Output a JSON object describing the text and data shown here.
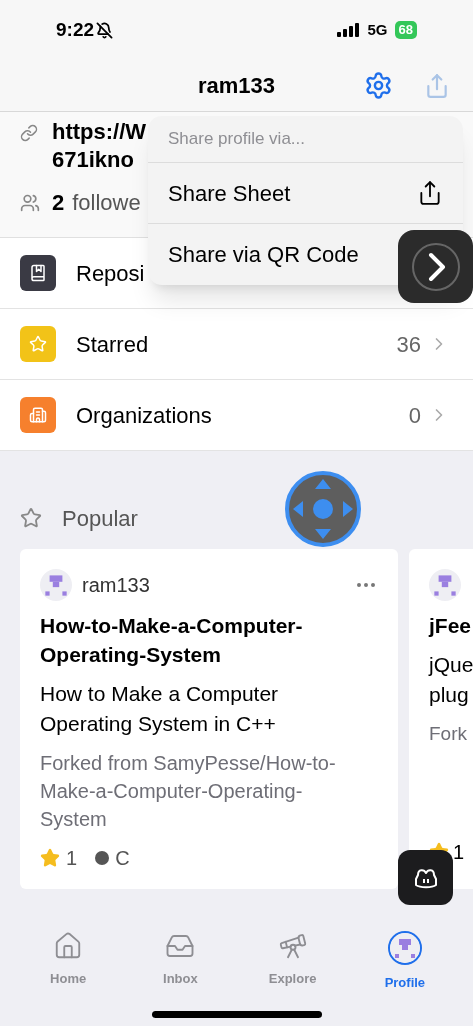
{
  "status_bar": {
    "time": "9:22",
    "network": "5G",
    "battery": "68"
  },
  "nav": {
    "title": "ram133"
  },
  "profile": {
    "link_lines": [
      "https://W",
      "671ikno"
    ],
    "followers_count": "2",
    "followers_label": "followe"
  },
  "share_menu": {
    "header": "Share profile via...",
    "items": [
      {
        "kind": "sheet",
        "label": "Share Sheet"
      },
      {
        "kind": "qr",
        "label": "Share via QR Code"
      }
    ]
  },
  "rows": [
    {
      "kind": "repo",
      "label": "Reposi",
      "color": "#3a3a44"
    },
    {
      "kind": "star",
      "label": "Starred",
      "count": "36",
      "color": "#f2c318"
    },
    {
      "kind": "org",
      "label": "Organizations",
      "count": "0",
      "color": "#f6802d"
    }
  ],
  "popular": {
    "title": "Popular",
    "cards": [
      {
        "kind": "full",
        "owner": "ram133",
        "name": "How-to-Make-a-Computer-Operating-System",
        "description": "How to Make a Computer Operating System in C++",
        "fork_note": "Forked from SamyPesse/How-to-Make-a-Computer-Operating-System",
        "stars": "1",
        "language": "C",
        "color": "#555555"
      },
      {
        "kind": "cut",
        "name": "jFee",
        "description_lines": [
          "jQue",
          "plug"
        ],
        "fork_note": "Fork",
        "stars": "1"
      }
    ]
  },
  "tabs": [
    {
      "label": "Home",
      "selected": false
    },
    {
      "label": "Inbox",
      "selected": false
    },
    {
      "label": "Explore",
      "selected": false
    },
    {
      "label": "Profile",
      "selected": true
    }
  ]
}
